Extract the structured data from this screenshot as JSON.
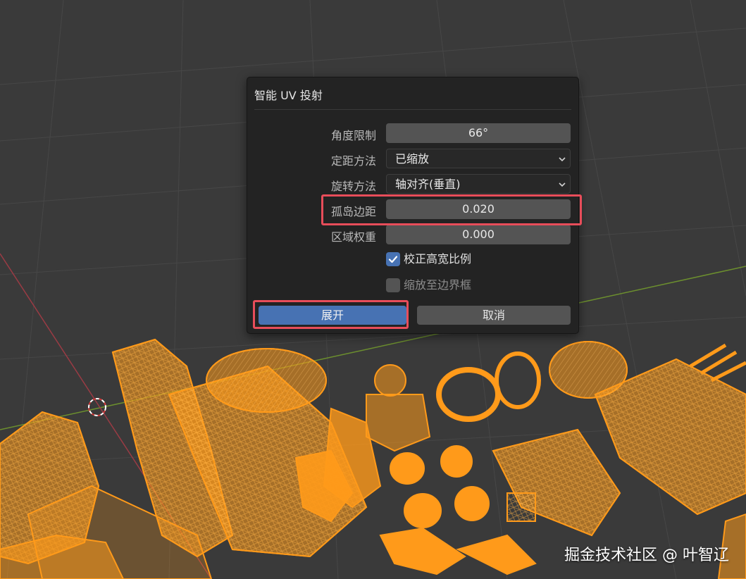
{
  "dialog": {
    "title": "智能 UV 投射",
    "fields": [
      {
        "label": "角度限制",
        "value": "66°"
      },
      {
        "label": "定距方法",
        "value": "已缩放"
      },
      {
        "label": "旋转方法",
        "value": "轴对齐(垂直)"
      },
      {
        "label": "孤岛边距",
        "value": "0.020"
      },
      {
        "label": "区域权重",
        "value": "0.000"
      }
    ],
    "checkboxes": [
      {
        "label": "校正高宽比例",
        "checked": true
      },
      {
        "label": "缩放至边界框",
        "checked": false
      }
    ],
    "buttons": {
      "confirm": "展开",
      "cancel": "取消"
    }
  },
  "watermark": "掘金技术社区 @ 叶智辽",
  "colors": {
    "viewport_bg": "#3a3a3a",
    "dialog_bg": "#232323",
    "field_bg": "#545454",
    "accent_blue": "#4772b3",
    "highlight_red": "#e84d5a",
    "wireframe_orange": "#ff9a1a"
  }
}
